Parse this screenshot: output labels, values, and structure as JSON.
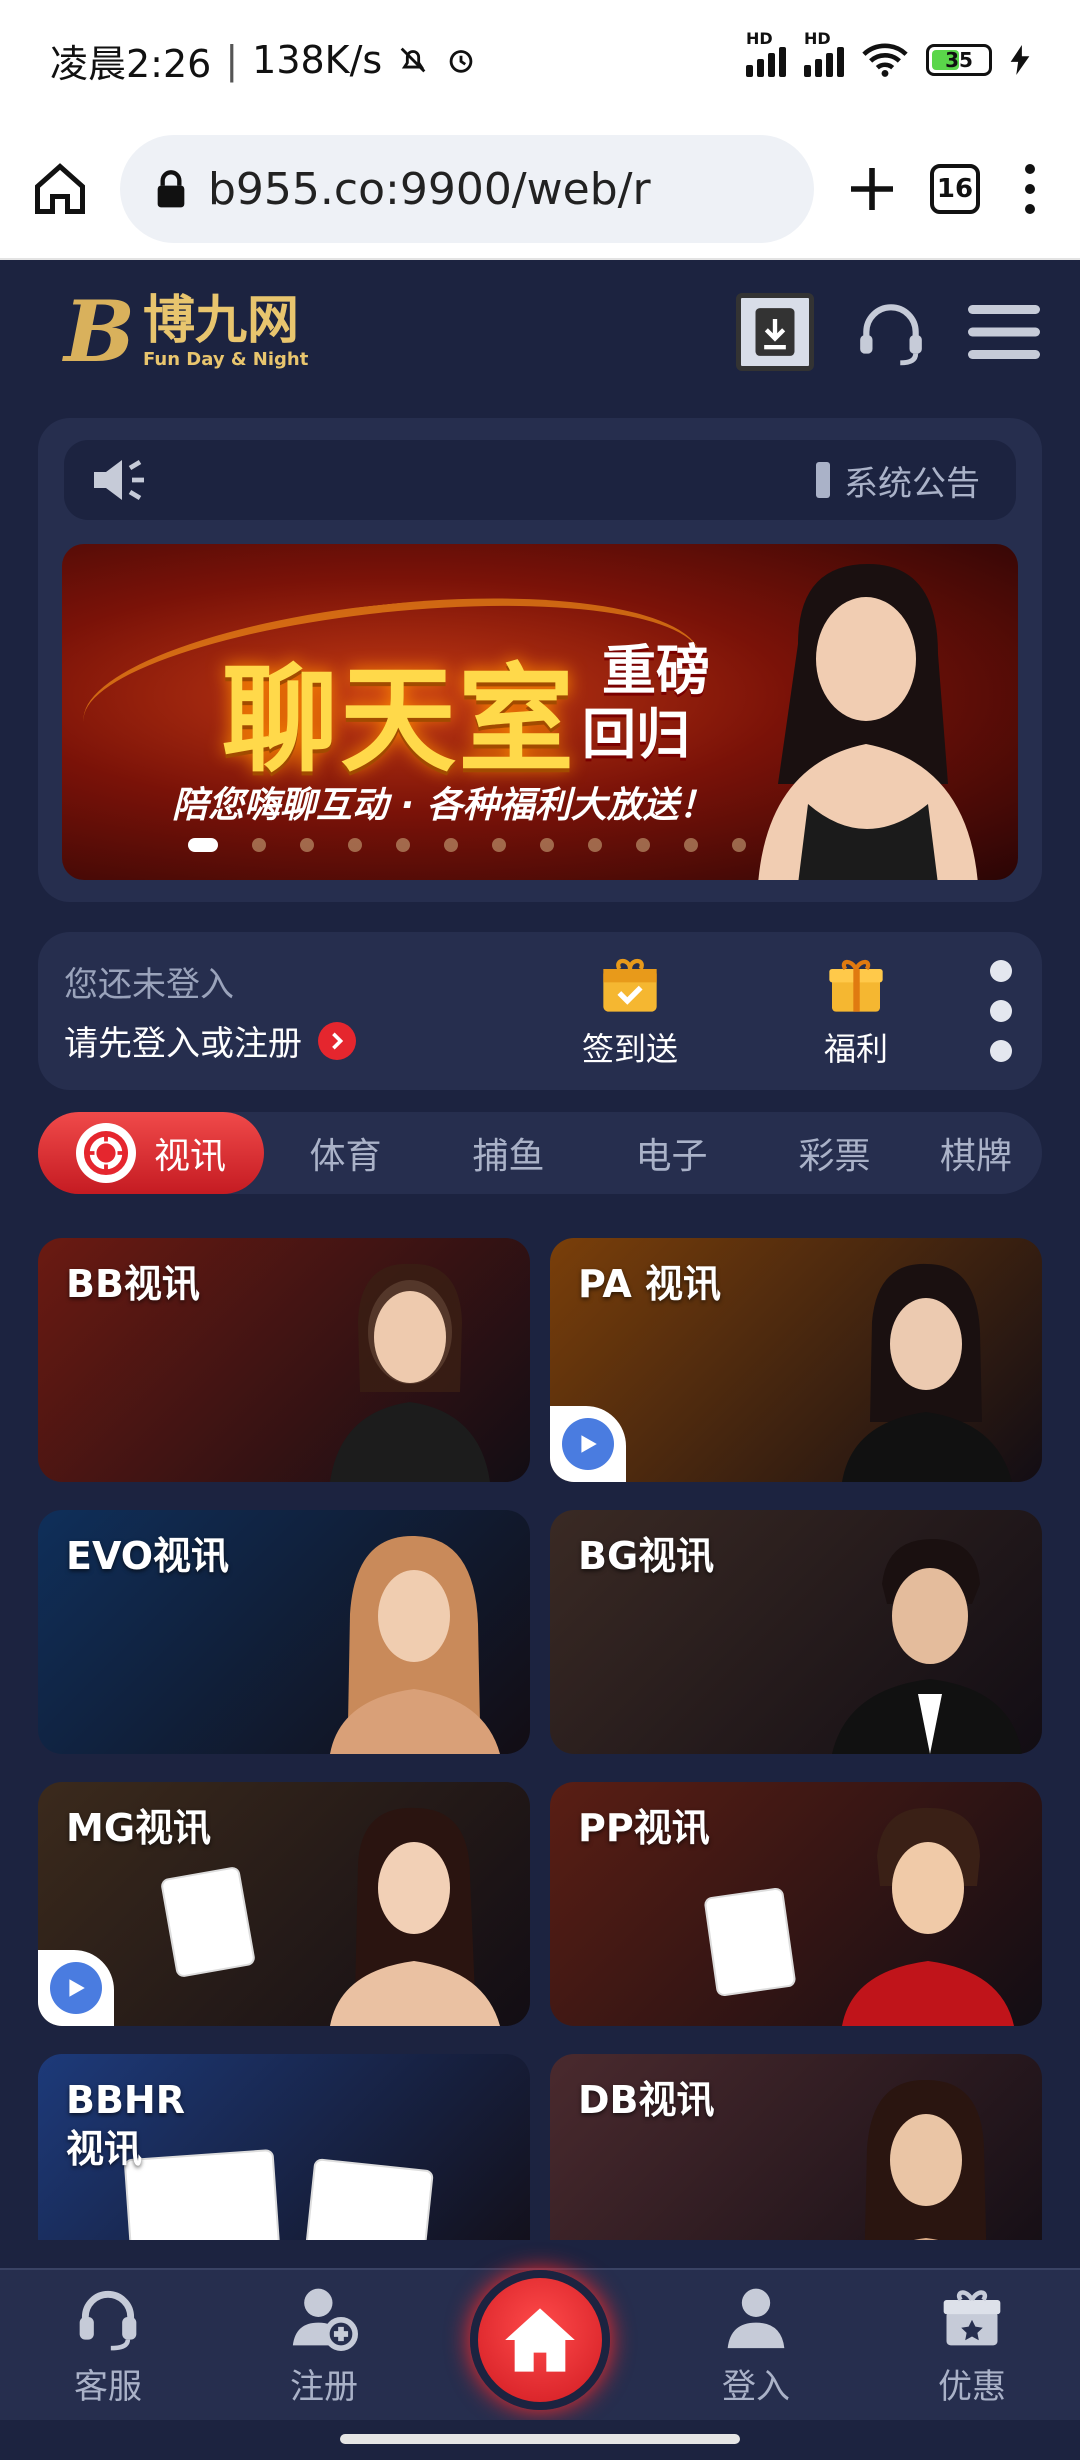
{
  "status_bar": {
    "time": "凌晨2:26",
    "speed": "138K/s",
    "battery": "35",
    "network_label": "HD"
  },
  "browser": {
    "url": "b955.co:9900/web/r",
    "tab_count": "16"
  },
  "brand": {
    "logo_mark": "B",
    "name": "博九网",
    "slogan": "Fun Day & Night"
  },
  "notice": {
    "label": "系统公告"
  },
  "banner": {
    "title": "聊天室",
    "sub1": "重磅",
    "sub2": "回归",
    "tagline": "陪您嗨聊互动 · 各种福利大放送！",
    "slide_count": 12,
    "active_slide": 1
  },
  "login": {
    "status": "您还未登入",
    "prompt": "请先登入或注册",
    "checkin_label": "签到送",
    "welfare_label": "福利"
  },
  "categories": [
    {
      "label": "视讯"
    },
    {
      "label": "体育"
    },
    {
      "label": "捕鱼"
    },
    {
      "label": "电子"
    },
    {
      "label": "彩票"
    },
    {
      "label": "棋牌"
    }
  ],
  "games": [
    {
      "title": "BB视讯",
      "bg": "#6b1a12"
    },
    {
      "title": "PA 视讯",
      "bg": "#7a3f0a"
    },
    {
      "title": "EVO视讯",
      "bg": "#0f2f5a"
    },
    {
      "title": "BG视讯",
      "bg": "#3a2a24"
    },
    {
      "title": "MG视讯",
      "bg": "#3b2a1c"
    },
    {
      "title": "PP视讯",
      "bg": "#5a1e14"
    },
    {
      "title": "BBHR视讯",
      "bg": "#1d3a7a"
    },
    {
      "title": "DB视讯",
      "bg": "#4a2a2e"
    }
  ],
  "bottom_nav": {
    "service": "客服",
    "register": "注册",
    "login": "登入",
    "promo": "优惠"
  },
  "colors": {
    "page_bg": "#1c2340",
    "panel_bg": "#262e4e",
    "accent_red": "#e5262e",
    "gold": "#e8c56e"
  }
}
